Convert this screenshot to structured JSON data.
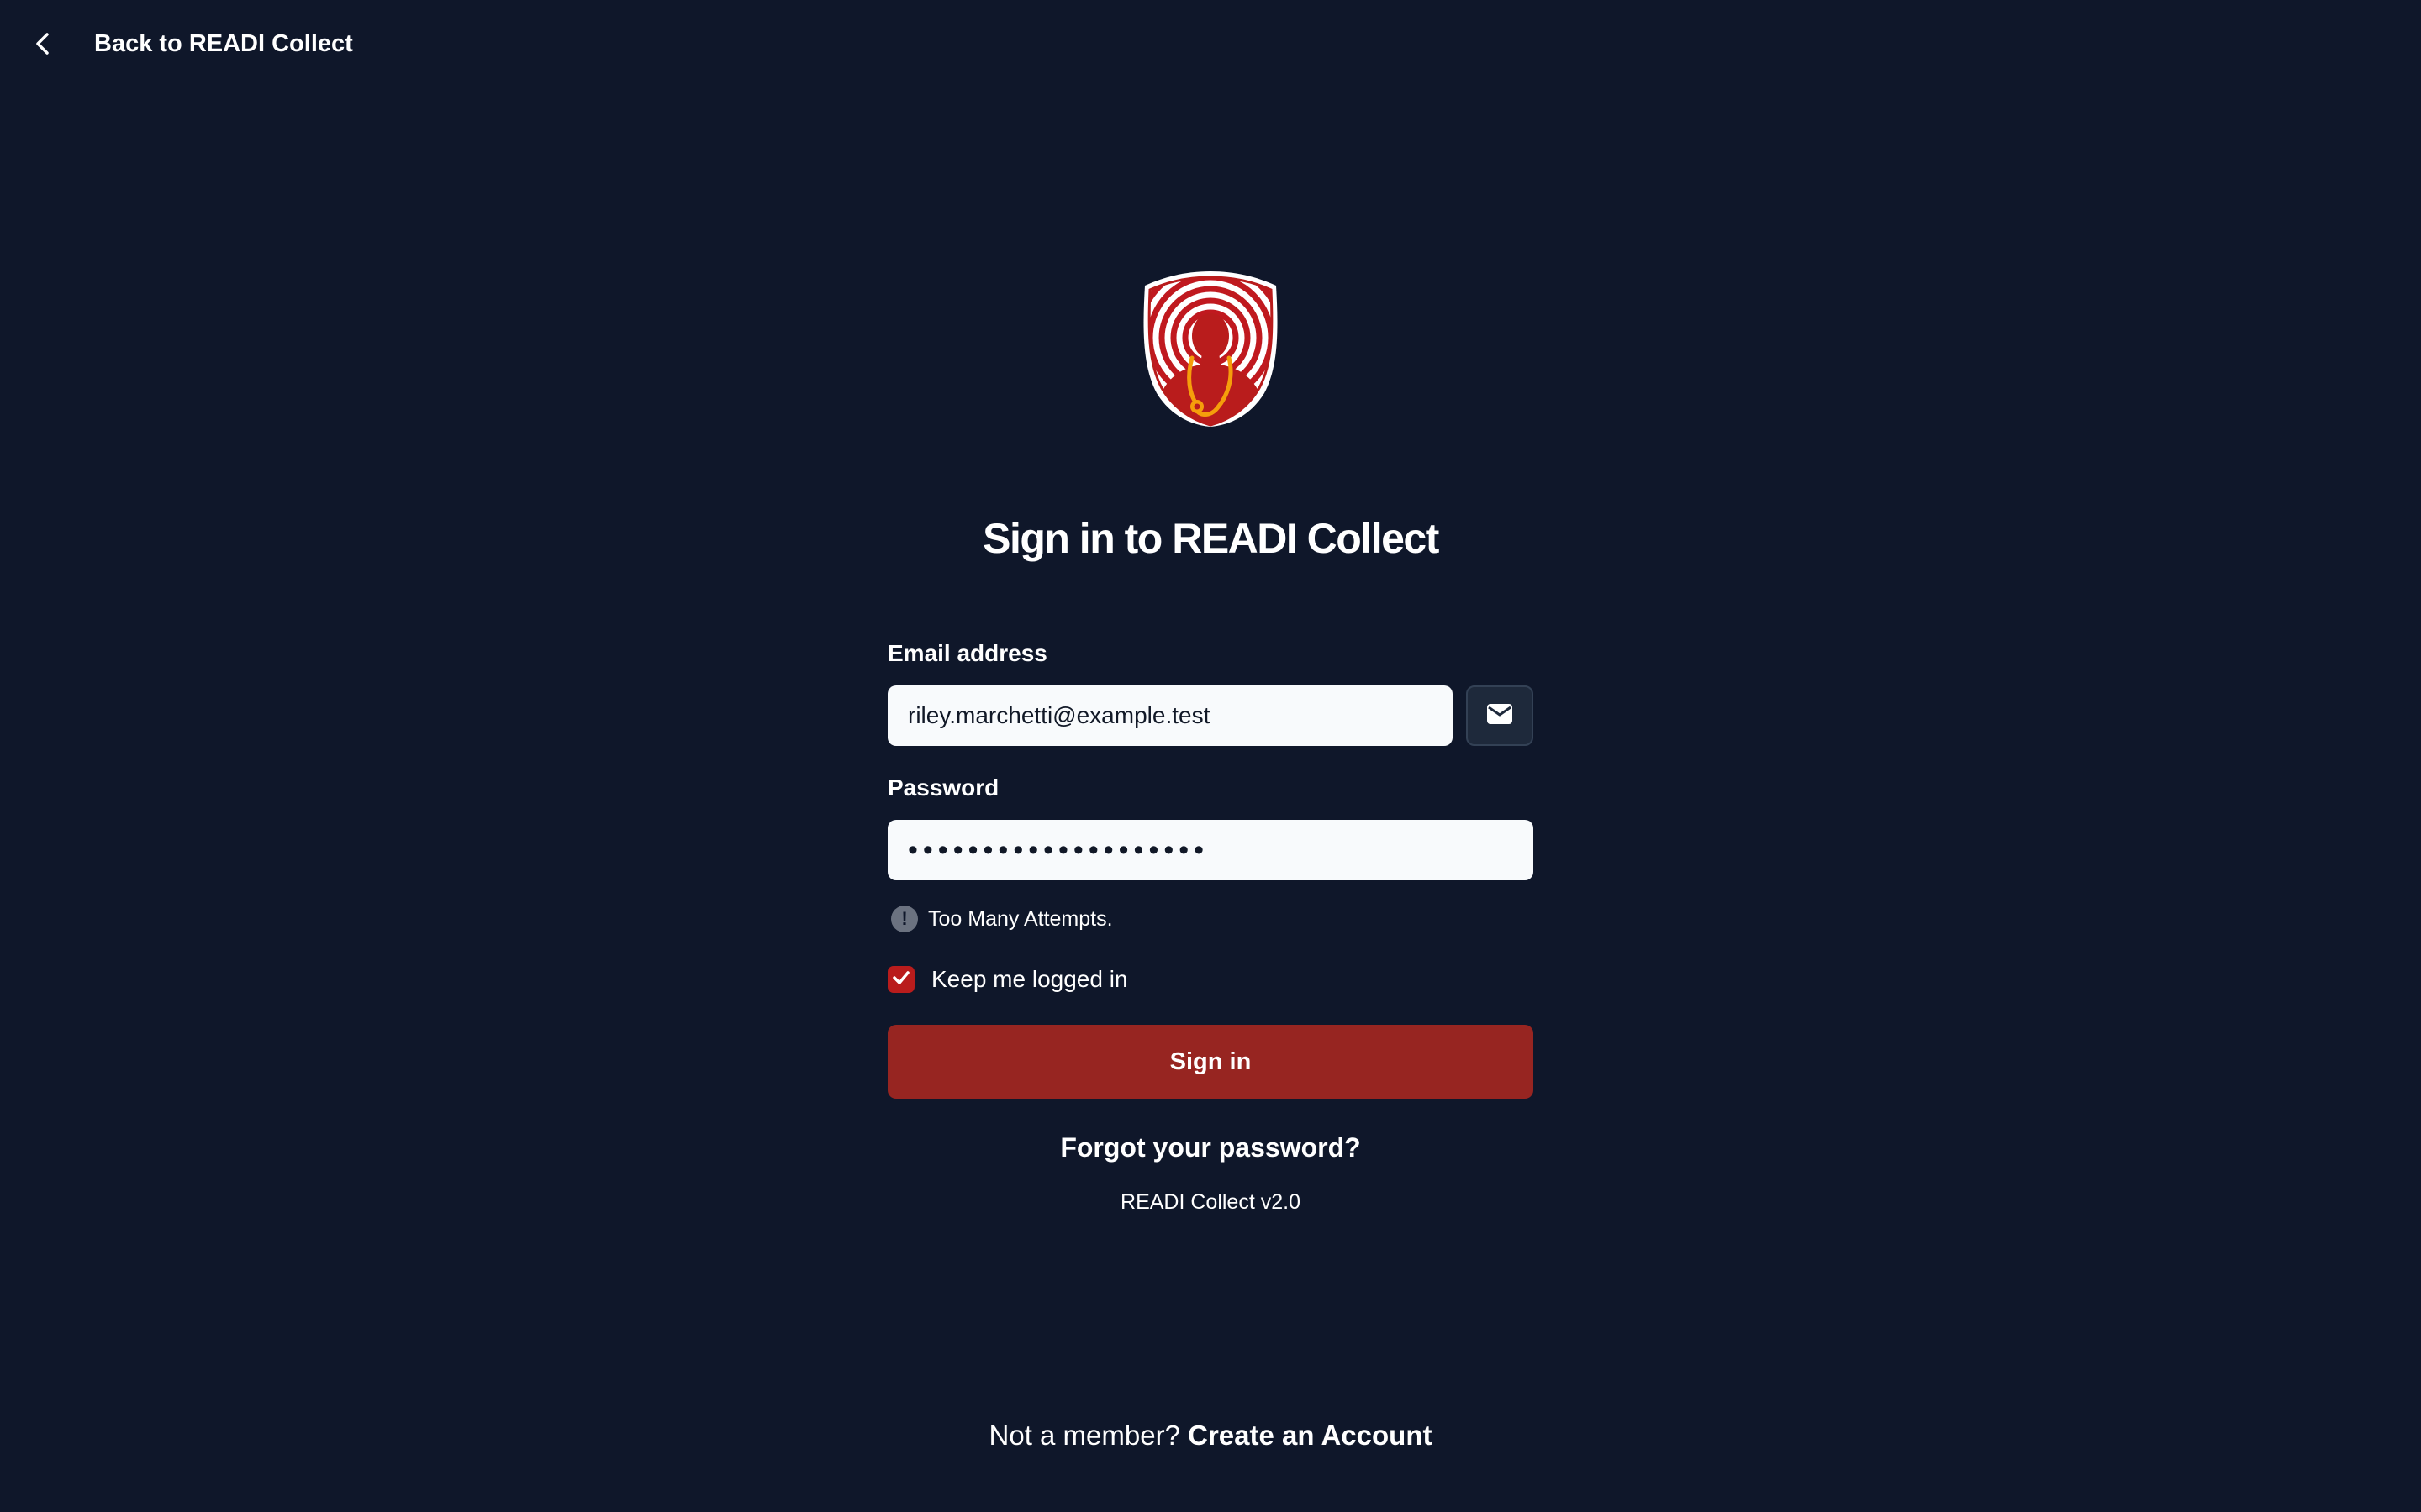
{
  "nav": {
    "back_label": "Back to READI Collect",
    "back_icon": "chevron-left-icon"
  },
  "logo": {
    "icon": "doctor-shield-logo",
    "colors": {
      "shield": "#b91c1c",
      "stethoscope": "#f59e0b",
      "outline": "#ffffff"
    }
  },
  "login": {
    "title": "Sign in to READI Collect",
    "email_label": "Email address",
    "email_value": "riley.marchetti@example.test",
    "email_icon": "envelope-icon",
    "password_label": "Password",
    "password_value": "••••••••••••••••••••",
    "error_icon": "exclamation-circle-icon",
    "error_text": "Too Many Attempts.",
    "remember_label": "Keep me logged in",
    "remember_checked": true,
    "submit_label": "Sign in",
    "forgot_label": "Forgot your password?",
    "version": "READI Collect v2.0"
  },
  "footer": {
    "prompt": "Not a member?",
    "signup_label": "Create an Account"
  },
  "colors": {
    "background": "#0f172a",
    "primary": "#972521",
    "checkbox": "#b91c1c",
    "input_bg": "#f8fafc"
  }
}
